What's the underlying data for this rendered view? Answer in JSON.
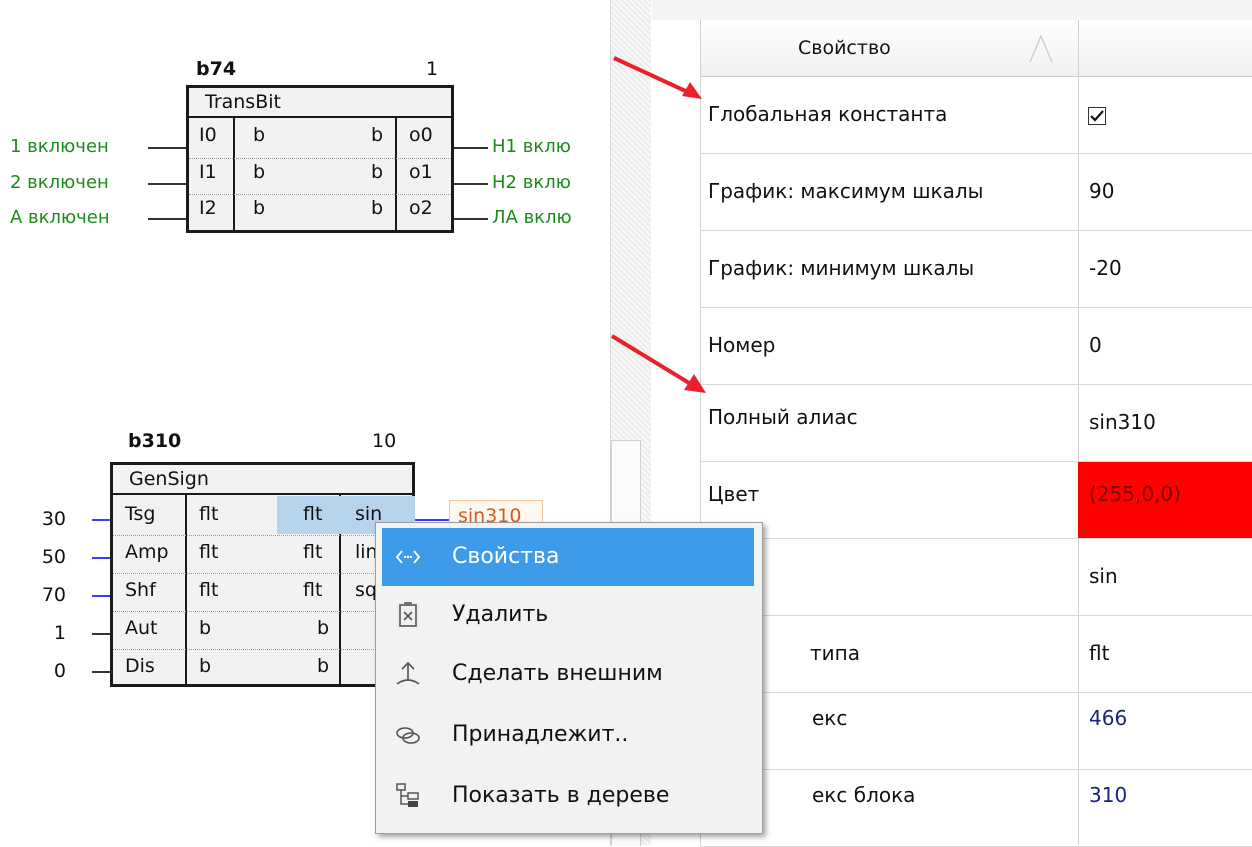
{
  "diagram": {
    "block1": {
      "name": "b74",
      "number": "1",
      "title": "TransBit",
      "rows": [
        {
          "in_label": "1 включен",
          "pin": "I0",
          "t1": "b",
          "t2": "b",
          "out": "o0",
          "out_label": "Н1 вклю"
        },
        {
          "in_label": "2 включен",
          "pin": "I1",
          "t1": "b",
          "t2": "b",
          "out": "o1",
          "out_label": "Н2 вклю"
        },
        {
          "in_label": "А включен",
          "pin": "I2",
          "t1": "b",
          "t2": "b",
          "out": "o2",
          "out_label": "ЛА вклю"
        }
      ]
    },
    "block2": {
      "name": "b310",
      "number": "10",
      "title": "GenSign",
      "rows": [
        {
          "in_value": "30",
          "pin": "Tsg",
          "t1": "flt",
          "t2": "flt",
          "out": "sin"
        },
        {
          "in_value": "50",
          "pin": "Amp",
          "t1": "flt",
          "t2": "flt",
          "out": "lin"
        },
        {
          "in_value": "70",
          "pin": "Shf",
          "t1": "flt",
          "t2": "flt",
          "out": "sq"
        },
        {
          "in_value": "1",
          "pin": "Aut",
          "t1": "b",
          "t2": "b",
          "out": ""
        },
        {
          "in_value": "0",
          "pin": "Dis",
          "t1": "b",
          "t2": "b",
          "out": ""
        }
      ],
      "output_tag": "sin310"
    }
  },
  "properties": {
    "header": "Свойство",
    "rows": [
      {
        "key": "Глобальная константа",
        "value": "",
        "checked": true
      },
      {
        "key": "График: максимум шкалы",
        "value": "90"
      },
      {
        "key": "График: минимум шкалы",
        "value": "-20"
      },
      {
        "key": "Номер",
        "value": "0"
      },
      {
        "key": "Полный алиас",
        "value": "sin310"
      },
      {
        "key": "Цвет",
        "value": "(255,0,0)",
        "color": "#ff0000"
      },
      {
        "key": "",
        "value": "sin"
      },
      {
        "key": "типа",
        "value": "flt"
      },
      {
        "key": "екс",
        "value": "466",
        "link": true
      },
      {
        "key": "екс блока",
        "value": "310",
        "link": true
      }
    ]
  },
  "context_menu": {
    "items": [
      {
        "label": "Свойства",
        "icon": "properties-icon",
        "selected": true
      },
      {
        "label": "Удалить",
        "icon": "delete-icon"
      },
      {
        "label": "Сделать внешним",
        "icon": "make-external-icon"
      },
      {
        "label": "Принадлежит..",
        "icon": "belongs-icon"
      },
      {
        "label": "Показать в дереве",
        "icon": "tree-icon"
      }
    ]
  },
  "colors": {
    "accent": "#3d9be9",
    "green_signal": "#1d8a1d",
    "link_blue": "#1a237e",
    "color_cell": "#ff0000",
    "arrow_red": "#e8212a"
  }
}
